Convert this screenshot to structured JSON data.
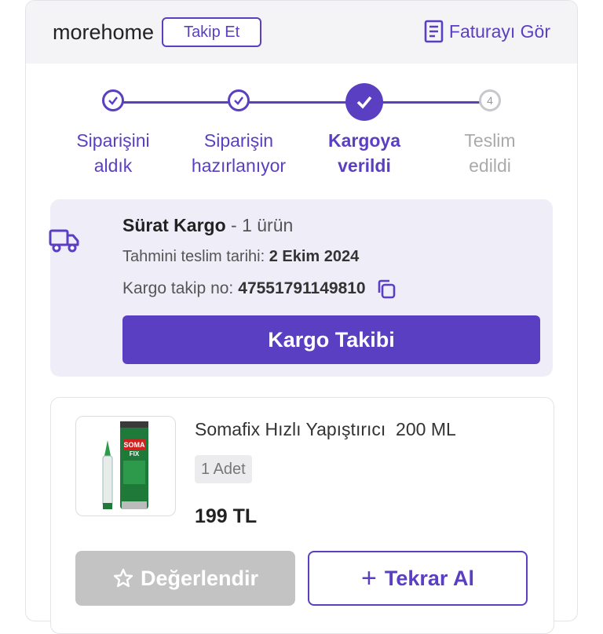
{
  "seller": {
    "name": "morehome",
    "follow_label": "Takip Et"
  },
  "invoice": {
    "label": "Faturayı Gör",
    "icon": "document-icon"
  },
  "steps": [
    {
      "line1": "Siparişini",
      "line2": "aldık",
      "state": "done"
    },
    {
      "line1": "Siparişin",
      "line2": "hazırlanıyor",
      "state": "done"
    },
    {
      "line1": "Kargoya",
      "line2": "verildi",
      "state": "active"
    },
    {
      "line1": "Teslim",
      "line2": "edildi",
      "state": "pending",
      "number": "4"
    }
  ],
  "cargo": {
    "company": "Sürat Kargo",
    "count": " - 1 ürün",
    "delivery_label": "Tahmini teslim tarihi: ",
    "delivery_date": "2 Ekim 2024",
    "tracking_label": "Kargo takip no:",
    "tracking_no": "47551791149810",
    "track_button": "Kargo Takibi"
  },
  "product": {
    "name": "Somafix Hızlı Yapıştırıcı  200 ML",
    "quantity": "1 Adet",
    "price": "199 TL",
    "rate_button": "Değerlendir",
    "reorder_button": "Tekrar Al",
    "reorder_icon": "+",
    "brand_top": "SOMA",
    "brand_bottom": "FIX"
  },
  "colors": {
    "accent": "#5b3fc2",
    "panel": "#efedf8",
    "disabled": "#c3c3c3"
  }
}
